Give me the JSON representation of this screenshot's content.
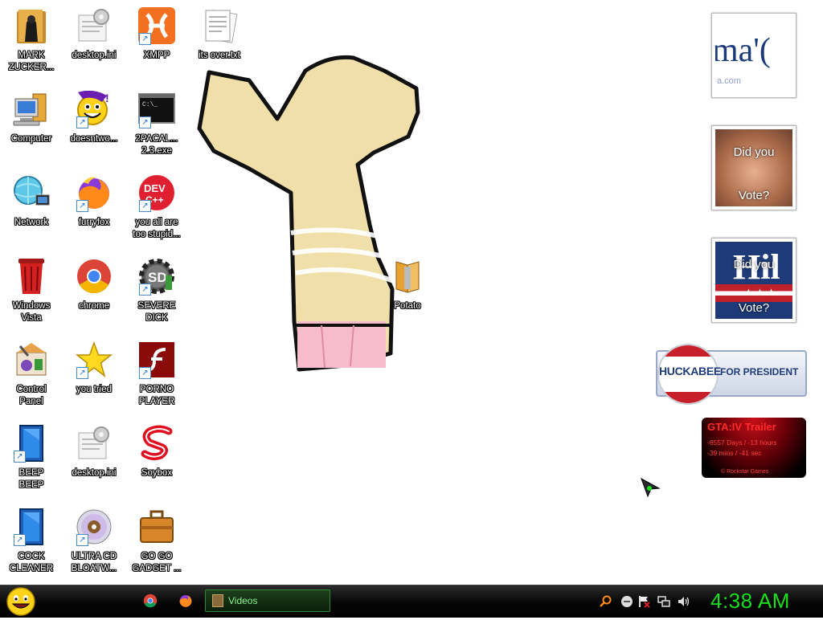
{
  "desktop": {
    "icons": [
      {
        "label": "MARK\nZUCKER...",
        "icon": "user-folder-icon"
      },
      {
        "label": "desktop.ini",
        "icon": "settings-file-icon"
      },
      {
        "label": "XMPP",
        "icon": "xampp-icon"
      },
      {
        "label": "its over.txt",
        "icon": "text-document-icon"
      },
      {
        "label": "Computer",
        "icon": "computer-icon"
      },
      {
        "label": "doesntwo...",
        "icon": "yahoo-messenger-icon"
      },
      {
        "label": "2PACAL...\n2.3.exe",
        "icon": "console-icon"
      },
      {
        "label": "Network",
        "icon": "network-globe-icon"
      },
      {
        "label": "furryfox",
        "icon": "firefox-icon"
      },
      {
        "label": "you all are\ntoo stupid...",
        "icon": "dev-cpp-icon"
      },
      {
        "label": "Windows\nVista",
        "icon": "recycle-bin-icon"
      },
      {
        "label": "chrome",
        "icon": "chrome-icon"
      },
      {
        "label": "SEVERE\nDICK",
        "icon": "sd-gear-icon"
      },
      {
        "label": "Control\nPanel",
        "icon": "control-panel-icon"
      },
      {
        "label": "you tried",
        "icon": "star-icon"
      },
      {
        "label": "PORNO\nPLAYER",
        "icon": "flash-icon"
      },
      {
        "label": "BEEP\nBEEP",
        "icon": "blue-panel-icon"
      },
      {
        "label": "desktop.ini",
        "icon": "settings-file-icon"
      },
      {
        "label": "Soybox",
        "icon": "soybox-icon"
      },
      {
        "label": "COCK\nCLEANER",
        "icon": "blue-panel-icon"
      },
      {
        "label": "ULTRA CD\nBLOATW...",
        "icon": "cd-icon"
      },
      {
        "label": "GO GO\nGADGET ...",
        "icon": "briefcase-icon"
      },
      {
        "label": "Potato",
        "icon": "potato-folder-icon"
      }
    ]
  },
  "gadgets": {
    "obama": {
      "text_big": "ma'(",
      "text_small": "a.com"
    },
    "mccain": {
      "line1": "Did you",
      "line2": "Vote?"
    },
    "hillary": {
      "line1": "Did you",
      "big": "Hil",
      "line2": "Vote?"
    },
    "huckabee": {
      "name": "HUCKABEE",
      "suffix": "FOR PRESIDENT"
    },
    "gta": {
      "title": "GTA:IV Trailer",
      "line1": "-6557 Days / -13 hours",
      "line2": "-39 mins / -41 sec",
      "footer": "© Rockstar Games"
    }
  },
  "taskbar": {
    "task_label": "Videos",
    "clock": "4:38 AM"
  },
  "colors": {
    "clock": "#18e018",
    "task_text": "#8cf58c",
    "gta_red": "#ff2a2a",
    "huckabee_blue": "#1e3a78"
  }
}
